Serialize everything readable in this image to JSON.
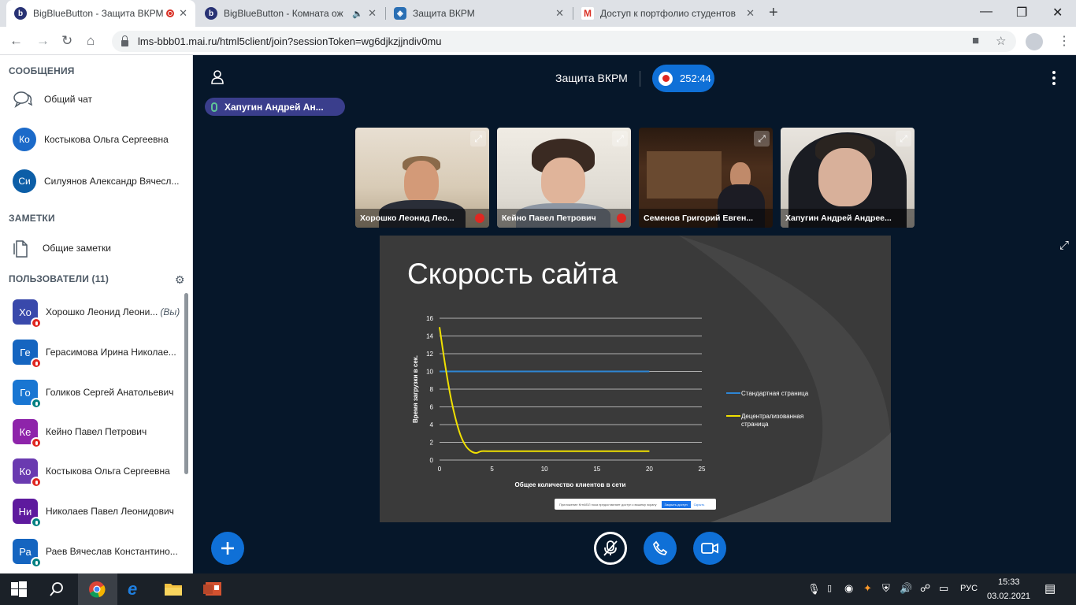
{
  "browser": {
    "tabs": [
      {
        "title": "BigBlueButton - Защита ВКРМ"
      },
      {
        "title": "BigBlueButton - Комната ож"
      },
      {
        "title": "Защита ВКРМ"
      },
      {
        "title": "Доступ к портфолио студентов"
      }
    ],
    "url": "lms-bbb01.mai.ru/html5client/join?sessionToken=wg6djkzjjndiv0mu"
  },
  "sidebar": {
    "messages_header": "СООБЩЕНИЯ",
    "public_chat": "Общий чат",
    "private_chats": [
      {
        "initials": "Ко",
        "name": "Костыкова Ольга Сергеевна",
        "color": "#1b6ac9"
      },
      {
        "initials": "Си",
        "name": "Силуянов Александр Вячесл...",
        "color": "#0c5ea7"
      }
    ],
    "notes_header": "ЗАМЕТКИ",
    "shared_notes": "Общие заметки",
    "users_header": "ПОЛЬЗОВАТЕЛИ (11)",
    "users": [
      {
        "initials": "Хо",
        "name": "Хорошко Леонид Леони...",
        "you": "(Вы)",
        "color": "#3949ab",
        "status": "mic-off"
      },
      {
        "initials": "Ге",
        "name": "Герасимова Ирина Николае...",
        "you": "",
        "color": "#1565c0",
        "status": "mic-off"
      },
      {
        "initials": "Го",
        "name": "Голиков Сергей Анатольевич",
        "you": "",
        "color": "#1976d2",
        "status": "listen"
      },
      {
        "initials": "Ке",
        "name": "Кейно Павел Петрович",
        "you": "",
        "color": "#8e24aa",
        "status": "mic-off"
      },
      {
        "initials": "Ко",
        "name": "Костыкова Ольга Сергеевна",
        "you": "",
        "color": "#6a3ab0",
        "status": "mic-off"
      },
      {
        "initials": "Ни",
        "name": "Николаев Павел Леонидович",
        "you": "",
        "color": "#5e1a9e",
        "status": "mic-on"
      },
      {
        "initials": "Ра",
        "name": "Раев Вячеслав Константино...",
        "you": "",
        "color": "#1565c0",
        "status": "listen"
      }
    ]
  },
  "header": {
    "meeting_title": "Защита ВКРМ",
    "timer": "252:44",
    "talker": "Хапугин Андрей Ан..."
  },
  "videos": [
    {
      "name": "Хорошко Леонид Лео..."
    },
    {
      "name": "Кейно Павел Петрович"
    },
    {
      "name": "Семенов Григорий Евген..."
    },
    {
      "name": "Хапугин Андрей Андрее..."
    }
  ],
  "slide": {
    "title": "Скорость сайта",
    "notice": "Приложение Ктн4/БЛ пока предоставляет доступ к вашему экрану",
    "notice_button": "Закрыть доступ",
    "notice_hide": "Скрыть"
  },
  "chart_data": {
    "type": "line",
    "title": "",
    "xlabel": "Общее количество клиентов в сети",
    "ylabel": "Время загрузки в сек.",
    "xlim": [
      0,
      25
    ],
    "ylim": [
      0,
      16
    ],
    "x_ticks": [
      "0",
      "5",
      "10",
      "15",
      "20",
      "25"
    ],
    "y_ticks": [
      "0",
      "2",
      "4",
      "6",
      "8",
      "10",
      "12",
      "14",
      "16"
    ],
    "grid": true,
    "legend_position": "right",
    "series": [
      {
        "name": "Стандартная страница",
        "color": "#2e86d4",
        "x": [
          0,
          20
        ],
        "y": [
          10,
          10
        ]
      },
      {
        "name": "Децентрализованная страница",
        "color": "#f0e000",
        "x": [
          0,
          0.5,
          1,
          1.5,
          2,
          2.5,
          3,
          3.5,
          4,
          5,
          10,
          15,
          20
        ],
        "y": [
          15,
          11,
          7.5,
          4.8,
          2.8,
          1.6,
          1.0,
          0.8,
          1.0,
          1.0,
          1.0,
          1.0,
          1.0
        ]
      }
    ]
  },
  "taskbar": {
    "lang": "РУС",
    "time": "15:33",
    "date": "03.02.2021"
  }
}
